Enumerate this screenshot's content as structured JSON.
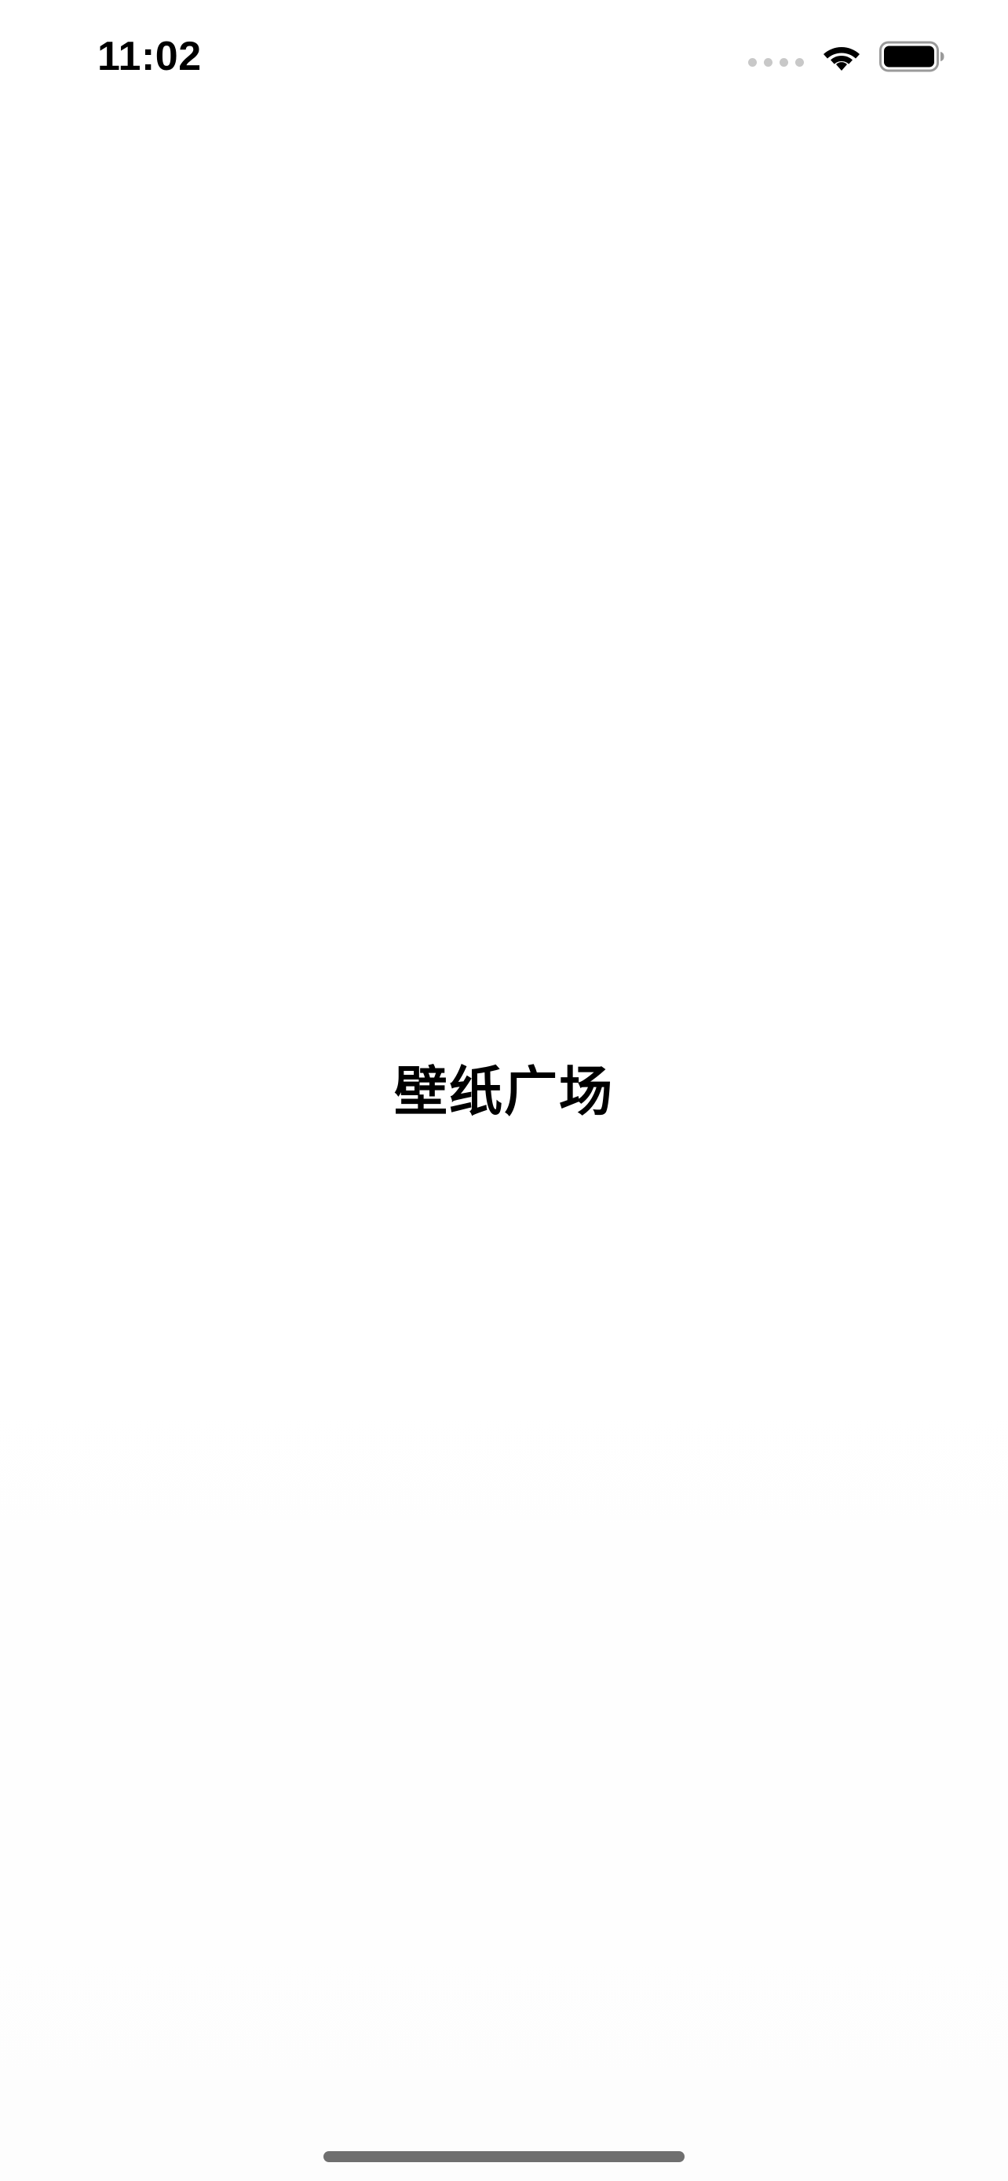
{
  "status_bar": {
    "time": "11:02",
    "icons": [
      "cellular-signal-icon",
      "wifi-icon",
      "battery-icon"
    ],
    "signal_color": "#c8c8c8",
    "battery_level": 1.0
  },
  "main": {
    "title": "壁纸广场"
  },
  "colors": {
    "background": "#ffffff",
    "text": "#000000",
    "home_indicator": "#6f6f6f"
  }
}
